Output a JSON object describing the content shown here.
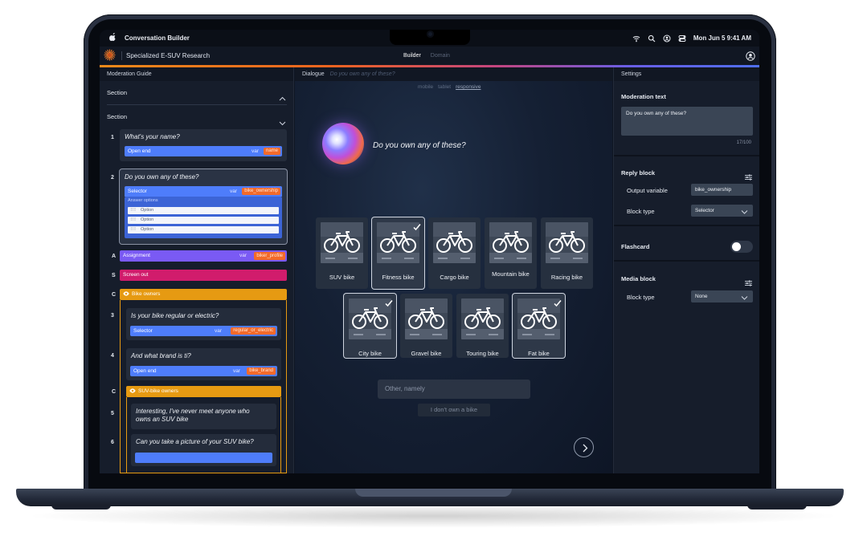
{
  "system_bar": {
    "app_name": "Conversation Builder",
    "datetime": "Mon Jun 5  9:41 AM"
  },
  "header": {
    "project": "Specialized E-SUV Research",
    "tabs": [
      {
        "label": "Builder",
        "active": true
      },
      {
        "label": "Domain",
        "active": false
      }
    ]
  },
  "left_panel": {
    "title": "Moderation Guide",
    "sections": [
      "Section",
      "Section"
    ],
    "questions": [
      {
        "index": "1",
        "text": "What's your name?",
        "type": "Open end",
        "var_label": "var",
        "var": "name"
      },
      {
        "index": "2",
        "text": "Do you own any of these?",
        "type": "Selector",
        "var_label": "var",
        "var": "bike_ownership",
        "answer_label": "Answer options",
        "options": [
          "Option",
          "Option",
          "Option"
        ]
      }
    ],
    "assignment": {
      "index": "A",
      "label": "Assignment",
      "var_label": "var",
      "var": "biker_profile"
    },
    "screen_out": {
      "index": "S",
      "label": "Screen out"
    },
    "group1": {
      "index": "C",
      "label": "Bike owners",
      "questions": [
        {
          "index": "3",
          "text": "Is your bike regular or electric?",
          "type": "Selector",
          "var_label": "var",
          "var": "regular_or_electric"
        },
        {
          "index": "4",
          "text": "And what brand is ti?",
          "type": "Open end",
          "var_label": "var",
          "var": "bike_brand"
        }
      ]
    },
    "group2": {
      "index": "C",
      "label": "SUV-bike owners",
      "questions": [
        {
          "index": "5",
          "text_lines": [
            "Interesting, I've never meet anyone who",
            "owns an SUV bike"
          ]
        },
        {
          "index": "6",
          "text": "Can you take a picture of your SUV bike?"
        }
      ]
    }
  },
  "dialogue": {
    "title": "Dialogue",
    "ghost": "Do you own any of these?",
    "devices": [
      {
        "label": "mobile",
        "active": false
      },
      {
        "label": "tablet",
        "active": false
      },
      {
        "label": "responsive",
        "active": true
      }
    ],
    "question": "Do you own any of these?",
    "bikes_row1": [
      {
        "name": "SUV bike",
        "selected": false
      },
      {
        "name": "Fitness bike",
        "selected": true
      },
      {
        "name": "Cargo bike",
        "selected": false
      },
      {
        "name": "Mountain bike",
        "selected": false
      },
      {
        "name": "Racing bike",
        "selected": false
      }
    ],
    "bikes_row2": [
      {
        "name": "City bike",
        "selected": true
      },
      {
        "name": "Gravel bike",
        "selected": false
      },
      {
        "name": "Touring bike",
        "selected": false
      },
      {
        "name": "Fat bike",
        "selected": true
      }
    ],
    "other_placeholder": "Other, namely",
    "no_bike": "I don't own a bike"
  },
  "settings": {
    "title": "Settings",
    "moderation_label": "Moderation text",
    "moderation_value": "Do you own any of these?",
    "counter": "17/100",
    "reply_block": "Reply block",
    "output_variable_label": "Output variable",
    "output_variable_value": "bike_ownership",
    "block_type_label": "Block type",
    "block_type_value": "Selector",
    "flashcard_label": "Flashcard",
    "flashcard_on": false,
    "media_block": "Media block",
    "media_block_type_label": "Block type",
    "media_block_type_value": "None"
  }
}
